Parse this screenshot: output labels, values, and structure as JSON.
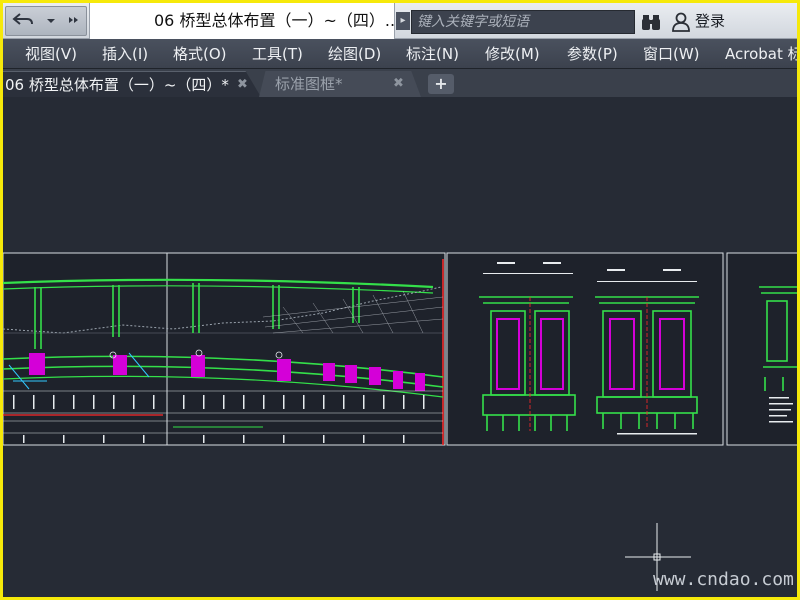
{
  "window": {
    "doc_title": "06 桥型总体布置（一）~（四）....",
    "search_placeholder": "键入关键字或短语",
    "login_label": "登录"
  },
  "quick_access": {
    "icons": [
      "undo-icon",
      "dropdown-arrow-icon",
      "more-icon"
    ]
  },
  "menu": {
    "items": [
      {
        "label": "视图(V)"
      },
      {
        "label": "插入(I)"
      },
      {
        "label": "格式(O)"
      },
      {
        "label": "工具(T)"
      },
      {
        "label": "绘图(D)"
      },
      {
        "label": "标注(N)"
      },
      {
        "label": "修改(M)"
      },
      {
        "label": "参数(P)"
      },
      {
        "label": "窗口(W)"
      },
      {
        "label": "Acrobat 标"
      }
    ]
  },
  "tabs": [
    {
      "label": "06 桥型总体布置（一）~（四）*",
      "active": true
    },
    {
      "label": "标准图框*",
      "active": false
    }
  ],
  "tab_close_glyph": "✖",
  "tab_add_glyph": "+",
  "canvas": {
    "background": "#262b35",
    "watermark": "www.cndao.com"
  },
  "colors": {
    "accent_yellow": "#f6e90a",
    "cad_green": "#34e04a",
    "cad_magenta": "#d400d8",
    "cad_white": "#e8ecef",
    "cad_red": "#ff2a2a",
    "cad_yellow": "#ffe82a"
  }
}
